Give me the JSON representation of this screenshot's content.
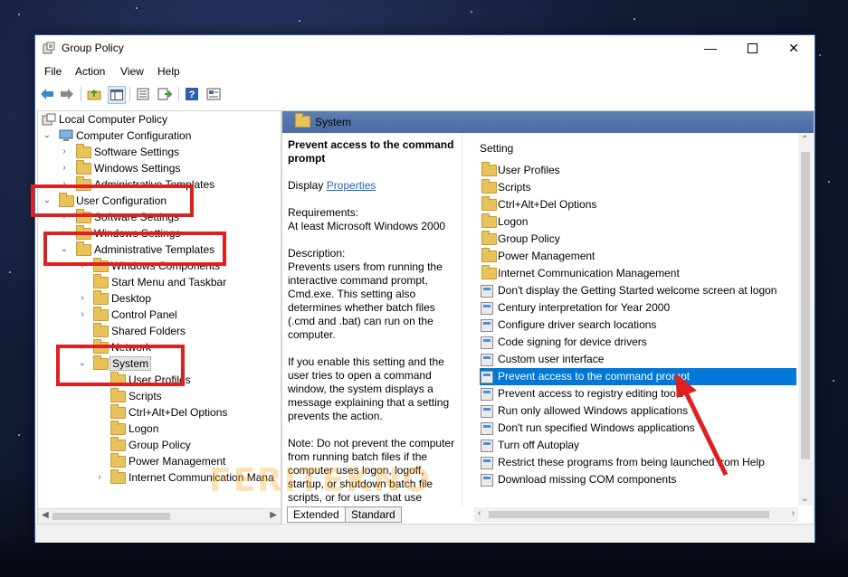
{
  "window": {
    "title": "Group Policy"
  },
  "menu": [
    "File",
    "Action",
    "View",
    "Help"
  ],
  "tree": [
    {
      "label": "Local Computer Policy",
      "chevron": ""
    },
    {
      "label": "Computer Configuration",
      "chevron": "v"
    },
    {
      "label": "Software Settings",
      "chevron": ">"
    },
    {
      "label": "Windows Settings",
      "chevron": ">"
    },
    {
      "label": "Administrative Templates",
      "chevron": ">"
    },
    {
      "label": "User Configuration",
      "chevron": "v"
    },
    {
      "label": "Software Settings",
      "chevron": ">"
    },
    {
      "label": "Windows Settings",
      "chevron": ">"
    },
    {
      "label": "Administrative Templates",
      "chevron": "v"
    },
    {
      "label": "Windows Components",
      "chevron": ">"
    },
    {
      "label": "Start Menu and Taskbar",
      "chevron": ""
    },
    {
      "label": "Desktop",
      "chevron": ">"
    },
    {
      "label": "Control Panel",
      "chevron": ">"
    },
    {
      "label": "Shared Folders",
      "chevron": ""
    },
    {
      "label": "Network",
      "chevron": ">"
    },
    {
      "label": "System",
      "chevron": "v"
    },
    {
      "label": "User Profiles",
      "chevron": ""
    },
    {
      "label": "Scripts",
      "chevron": ""
    },
    {
      "label": "Ctrl+Alt+Del Options",
      "chevron": ""
    },
    {
      "label": "Logon",
      "chevron": ""
    },
    {
      "label": "Group Policy",
      "chevron": ""
    },
    {
      "label": "Power Management",
      "chevron": ""
    },
    {
      "label": "Internet Communication Mana",
      "chevron": ">"
    }
  ],
  "pane_header": "System",
  "description": {
    "title": "Prevent access to the command prompt",
    "display_label": "Display",
    "properties_link": "Properties",
    "requirements_label": "Requirements:",
    "requirements": "At least Microsoft Windows 2000",
    "description_label": "Description:",
    "description_text": "Prevents users from running the interactive command prompt, Cmd.exe. This setting also determines whether batch files (.cmd and .bat) can run on the computer.",
    "para2": "If you enable this setting and the user tries to open a command window, the system displays a message explaining that a setting prevents the action.",
    "para3": "Note: Do not prevent the computer from running batch files if the computer uses logon, logoff, startup, or shutdown batch file scripts, or for users that use"
  },
  "list": {
    "header": "Setting",
    "rows": [
      {
        "label": "User Profiles",
        "type": "folder"
      },
      {
        "label": "Scripts",
        "type": "folder"
      },
      {
        "label": "Ctrl+Alt+Del Options",
        "type": "folder"
      },
      {
        "label": "Logon",
        "type": "folder"
      },
      {
        "label": "Group Policy",
        "type": "folder"
      },
      {
        "label": "Power Management",
        "type": "folder"
      },
      {
        "label": "Internet Communication Management",
        "type": "folder"
      },
      {
        "label": "Don't display the Getting Started welcome screen at logon",
        "type": "policy"
      },
      {
        "label": "Century interpretation for Year 2000",
        "type": "policy"
      },
      {
        "label": "Configure driver search locations",
        "type": "policy"
      },
      {
        "label": "Code signing for device drivers",
        "type": "policy"
      },
      {
        "label": "Custom user interface",
        "type": "policy"
      },
      {
        "label": "Prevent access to the command prompt",
        "type": "policy",
        "selected": true
      },
      {
        "label": "Prevent access to registry editing tools",
        "type": "policy"
      },
      {
        "label": "Run only allowed Windows applications",
        "type": "policy"
      },
      {
        "label": "Don't run specified Windows applications",
        "type": "policy"
      },
      {
        "label": "Turn off Autoplay",
        "type": "policy"
      },
      {
        "label": "Restrict these programs from being launched from Help",
        "type": "policy"
      },
      {
        "label": "Download missing COM components",
        "type": "policy"
      }
    ]
  },
  "tabs": [
    "Extended",
    "Standard"
  ],
  "watermark": "FERITEKNO",
  "colors": {
    "selection": "#0078d7",
    "header": "#4a6ba3",
    "annotation": "#e02020"
  }
}
